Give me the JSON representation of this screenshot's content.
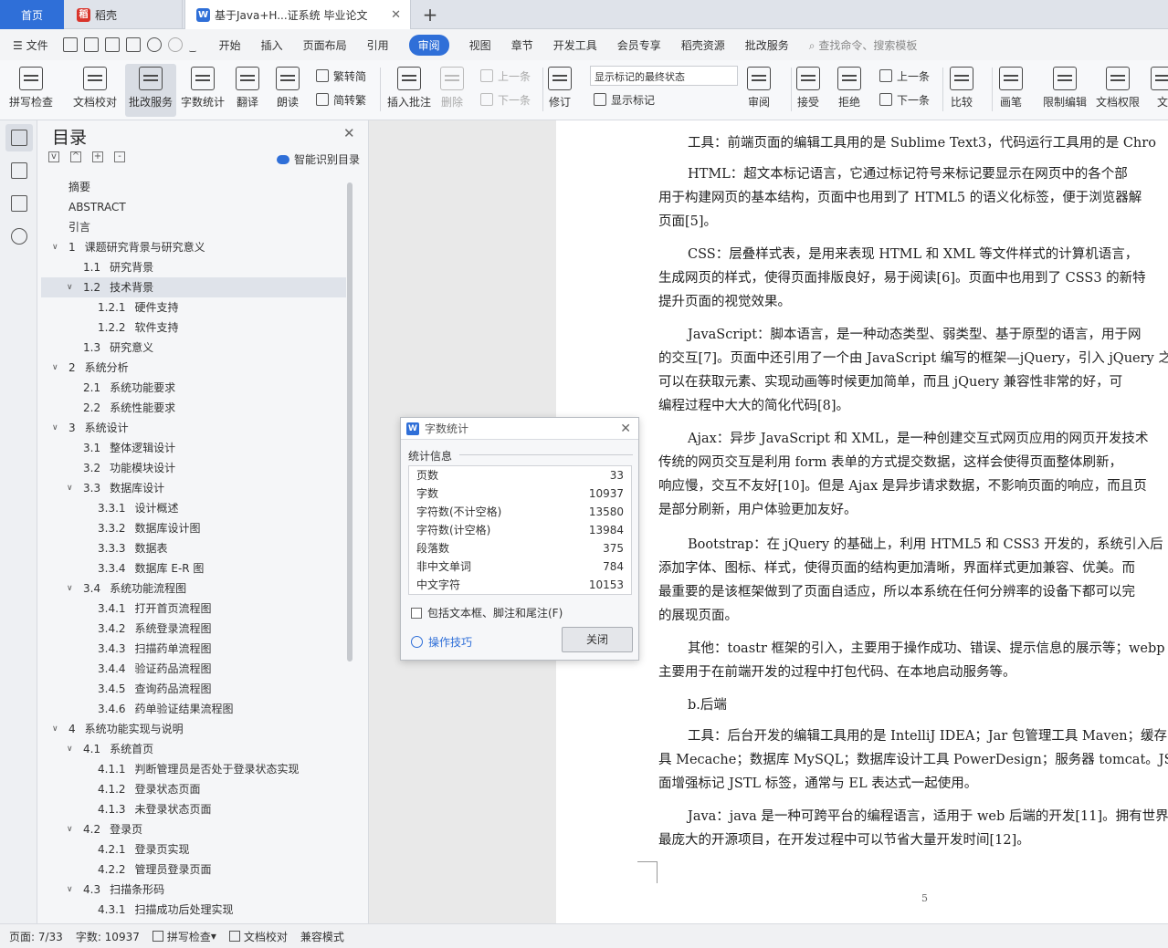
{
  "tabs": {
    "home": "首页",
    "wps": "稻壳",
    "doc": "基于Java+H...证系统 毕业论文",
    "add": "+"
  },
  "menu": {
    "file": "文件",
    "items": [
      "开始",
      "插入",
      "页面布局",
      "引用",
      "审阅",
      "视图",
      "章节",
      "开发工具",
      "会员专享",
      "稻壳资源",
      "批改服务"
    ],
    "active_index": 4,
    "search": "查找命令、搜索模板"
  },
  "ribbon": {
    "spell": "拼写检查",
    "doccheck": "文档校对",
    "review_service": "批改服务",
    "wordcount": "字数统计",
    "translate": "翻译",
    "read": "朗读",
    "trad": "繁转简",
    "simp": "简转繁",
    "insert_comment": "插入批注",
    "delete": "删除",
    "prev": "上一条",
    "next": "下一条",
    "revise": "修订",
    "show_mode": "显示标记的最终状态",
    "show_marks": "显示标记",
    "review": "审阅",
    "accept": "接受",
    "reject": "拒绝",
    "prev2": "上一条",
    "next2": "下一条",
    "compare": "比较",
    "pen": "画笔",
    "restrict": "限制编辑",
    "rights": "文档权限",
    "more": "文"
  },
  "toc": {
    "title": "目录",
    "smart": "智能识别目录",
    "items": [
      {
        "num": "",
        "text": "摘要",
        "level": 0,
        "arrow": ""
      },
      {
        "num": "",
        "text": "ABSTRACT",
        "level": 0,
        "arrow": ""
      },
      {
        "num": "",
        "text": "引言",
        "level": 0,
        "arrow": ""
      },
      {
        "num": "1",
        "text": "课题研究背景与研究意义",
        "level": 0,
        "arrow": "v"
      },
      {
        "num": "1.1",
        "text": "研究背景",
        "level": 1,
        "arrow": ""
      },
      {
        "num": "1.2",
        "text": "技术背景",
        "level": 1,
        "arrow": "v",
        "selected": true
      },
      {
        "num": "1.2.1",
        "text": "硬件支持",
        "level": 2,
        "arrow": ""
      },
      {
        "num": "1.2.2",
        "text": "软件支持",
        "level": 2,
        "arrow": ""
      },
      {
        "num": "1.3",
        "text": "研究意义",
        "level": 1,
        "arrow": ""
      },
      {
        "num": "2",
        "text": "系统分析",
        "level": 0,
        "arrow": "v"
      },
      {
        "num": "2.1",
        "text": "系统功能要求",
        "level": 1,
        "arrow": ""
      },
      {
        "num": "2.2",
        "text": "系统性能要求",
        "level": 1,
        "arrow": ""
      },
      {
        "num": "3",
        "text": "系统设计",
        "level": 0,
        "arrow": "v"
      },
      {
        "num": "3.1",
        "text": "整体逻辑设计",
        "level": 1,
        "arrow": ""
      },
      {
        "num": "3.2",
        "text": "功能模块设计",
        "level": 1,
        "arrow": ""
      },
      {
        "num": "3.3",
        "text": "数据库设计",
        "level": 1,
        "arrow": "v"
      },
      {
        "num": "3.3.1",
        "text": "设计概述",
        "level": 2,
        "arrow": ""
      },
      {
        "num": "3.3.2",
        "text": "数据库设计图",
        "level": 2,
        "arrow": ""
      },
      {
        "num": "3.3.3",
        "text": "数据表",
        "level": 2,
        "arrow": ""
      },
      {
        "num": "3.3.4",
        "text": "数据库 E-R 图",
        "level": 2,
        "arrow": ""
      },
      {
        "num": "3.4",
        "text": "系统功能流程图",
        "level": 1,
        "arrow": "v"
      },
      {
        "num": "3.4.1",
        "text": "打开首页流程图",
        "level": 2,
        "arrow": ""
      },
      {
        "num": "3.4.2",
        "text": "系统登录流程图",
        "level": 2,
        "arrow": ""
      },
      {
        "num": "3.4.3",
        "text": "扫描药单流程图",
        "level": 2,
        "arrow": ""
      },
      {
        "num": "3.4.4",
        "text": "验证药品流程图",
        "level": 2,
        "arrow": ""
      },
      {
        "num": "3.4.5",
        "text": "查询药品流程图",
        "level": 2,
        "arrow": ""
      },
      {
        "num": "3.4.6",
        "text": "药单验证结果流程图",
        "level": 2,
        "arrow": ""
      },
      {
        "num": "4",
        "text": "系统功能实现与说明",
        "level": 0,
        "arrow": "v"
      },
      {
        "num": "4.1",
        "text": "系统首页",
        "level": 1,
        "arrow": "v"
      },
      {
        "num": "4.1.1",
        "text": "判断管理员是否处于登录状态实现",
        "level": 2,
        "arrow": ""
      },
      {
        "num": "4.1.2",
        "text": "登录状态页面",
        "level": 2,
        "arrow": ""
      },
      {
        "num": "4.1.3",
        "text": "未登录状态页面",
        "level": 2,
        "arrow": ""
      },
      {
        "num": "4.2",
        "text": "登录页",
        "level": 1,
        "arrow": "v"
      },
      {
        "num": "4.2.1",
        "text": "登录页实现",
        "level": 2,
        "arrow": ""
      },
      {
        "num": "4.2.2",
        "text": "管理员登录页面",
        "level": 2,
        "arrow": ""
      },
      {
        "num": "4.3",
        "text": "扫描条形码",
        "level": 1,
        "arrow": "v"
      },
      {
        "num": "4.3.1",
        "text": "扫描成功后处理实现",
        "level": 2,
        "arrow": ""
      }
    ]
  },
  "document": {
    "paragraphs": [
      [
        "工具：前端页面的编辑工具用的是 Sublime Text3，代码运行工具用的是 Chro"
      ],
      [
        "HTML：超文本标记语言，它通过标记符号来标记要显示在网页中的各个部",
        "用于构建网页的基本结构，页面中也用到了 HTML5 的语义化标签，便于浏览器解",
        "页面[5]。"
      ],
      [
        "CSS：层叠样式表，是用来表现 HTML 和 XML 等文件样式的计算机语言，",
        "生成网页的样式，使得页面排版良好，易于阅读[6]。页面中也用到了 CSS3 的新特",
        "提升页面的视觉效果。"
      ],
      [
        "JavaScript：脚本语言，是一种动态类型、弱类型、基于原型的语言，用于网",
        "的交互[7]。页面中还引用了一个由 JavaScript 编写的框架—jQuery，引入 jQuery 之",
        "可以在获取元素、实现动画等时候更加简单，而且 jQuery 兼容性非常的好，可",
        "编程过程中大大的简化代码[8]。"
      ],
      [
        "Ajax：异步 JavaScript 和 XML，是一种创建交互式网页应用的网页开发技术",
        "传统的网页交互是利用 form 表单的方式提交数据，这样会使得页面整体刷新，",
        "响应慢，交互不友好[10]。但是 Ajax 是异步请求数据，不影响页面的响应，而且页",
        "是部分刷新，用户体验更加友好。"
      ],
      [
        "Bootstrap：在 jQuery 的基础上，利用 HTML5 和 CSS3 开发的，系统引入后",
        "添加字体、图标、样式，使得页面的结构更加清晰，界面样式更加兼容、优美。而",
        "最重要的是该框架做到了页面自适应，所以本系统在任何分辨率的设备下都可以完",
        "的展现页面。"
      ],
      [
        "其他：toastr 框架的引入，主要用于操作成功、错误、提示信息的展示等；webp",
        "主要用于在前端开发的过程中打包代码、在本地启动服务等。"
      ],
      [
        "b.后端"
      ],
      [
        "工具：后台开发的编辑工具用的是 IntelliJ IDEA；Jar 包管理工具 Maven；缓存",
        "具 Mecache；数据库 MySQL；数据库设计工具 PowerDesign；服务器 tomcat。JSP",
        "面增强标记 JSTL 标签，通常与 EL 表达式一起使用。"
      ],
      [
        "Java：java 是一种可跨平台的编程语言，适用于 web 后端的开发[11]。拥有世界",
        "最庞大的开源项目，在开发过程中可以节省大量开发时间[12]。"
      ]
    ],
    "page_number": "5"
  },
  "dialog": {
    "title": "字数统计",
    "section": "统计信息",
    "stats": [
      {
        "label": "页数",
        "value": "33"
      },
      {
        "label": "字数",
        "value": "10937"
      },
      {
        "label": "字符数(不计空格)",
        "value": "13580"
      },
      {
        "label": "字符数(计空格)",
        "value": "13984"
      },
      {
        "label": "段落数",
        "value": "375"
      },
      {
        "label": "非中文单词",
        "value": "784"
      },
      {
        "label": "中文字符",
        "value": "10153"
      }
    ],
    "checkbox": "包括文本框、脚注和尾注(F)",
    "tips": "操作技巧",
    "close": "关闭"
  },
  "status": {
    "page": "页面: 7/33",
    "words": "字数: 10937",
    "spell": "拼写检查",
    "doccheck": "文档校对",
    "compat": "兼容模式"
  }
}
